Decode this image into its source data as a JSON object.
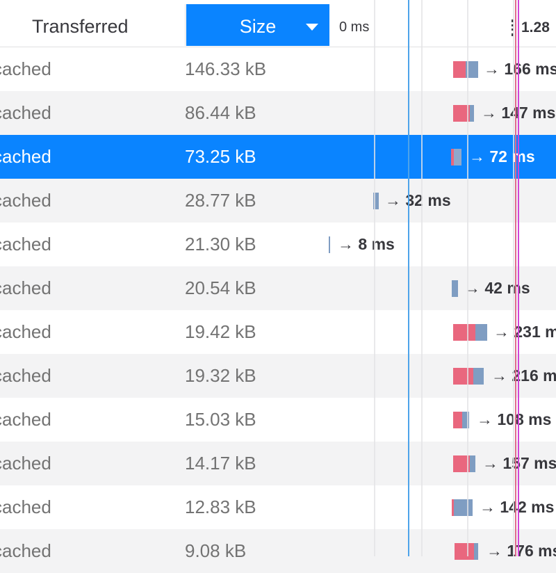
{
  "header": {
    "transferred_label": "Transferred",
    "size_label": "Size",
    "size_sort": "descending",
    "sort_icon": "sort-descending-icon",
    "tick_start": "0 ms",
    "tick_next": "1.28"
  },
  "colors": {
    "accent": "#0a84ff",
    "wait": "#e9677e",
    "receive": "#7f9dc2",
    "dom_content_loaded_line": "#4da3ea",
    "load_line": "#d044d8"
  },
  "rows": [
    {
      "transferred": "cached",
      "size": "146.33 kB",
      "timing": "→ 166 ms",
      "selected": false
    },
    {
      "transferred": "cached",
      "size": "86.44 kB",
      "timing": "→ 147 ms",
      "selected": false
    },
    {
      "transferred": "cached",
      "size": "73.25 kB",
      "timing": "→ 72 ms",
      "selected": true
    },
    {
      "transferred": "cached",
      "size": "28.77 kB",
      "timing": "→ 32 ms",
      "selected": false
    },
    {
      "transferred": "cached",
      "size": "21.30 kB",
      "timing": "→ 8 ms",
      "selected": false
    },
    {
      "transferred": "cached",
      "size": "20.54 kB",
      "timing": "→ 42 ms",
      "selected": false
    },
    {
      "transferred": "cached",
      "size": "19.42 kB",
      "timing": "→ 231 ms",
      "selected": false
    },
    {
      "transferred": "cached",
      "size": "19.32 kB",
      "timing": "→ 216 ms",
      "selected": false
    },
    {
      "transferred": "cached",
      "size": "15.03 kB",
      "timing": "→ 108 ms",
      "selected": false
    },
    {
      "transferred": "cached",
      "size": "14.17 kB",
      "timing": "→ 157 ms",
      "selected": false
    },
    {
      "transferred": "cached",
      "size": "12.83 kB",
      "timing": "→ 142 ms",
      "selected": false
    },
    {
      "transferred": "cached",
      "size": "9.08 kB",
      "timing": "→ 176 ms",
      "selected": false
    }
  ]
}
